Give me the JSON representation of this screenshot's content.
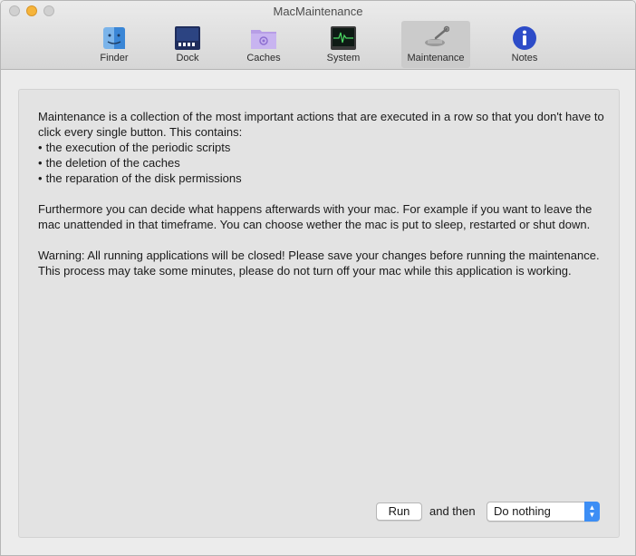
{
  "window": {
    "title": "MacMaintenance"
  },
  "toolbar": {
    "items": [
      {
        "label": "Finder",
        "icon": "finder-icon"
      },
      {
        "label": "Dock",
        "icon": "dock-icon"
      },
      {
        "label": "Caches",
        "icon": "caches-folder-icon"
      },
      {
        "label": "System",
        "icon": "activity-monitor-icon"
      },
      {
        "label": "Maintenance",
        "icon": "wrench-icon",
        "selected": true
      },
      {
        "label": "Notes",
        "icon": "info-icon"
      }
    ]
  },
  "main": {
    "intro": "Maintenance is a collection of the most important actions that are executed in a row so that you don't have to click every single button. This contains:",
    "bullets": [
      "the execution of the periodic scripts",
      "the deletion of the caches",
      "the reparation of the disk permissions"
    ],
    "paragraph2": "Furthermore you can decide what happens afterwards with your mac. For example if you want to leave the mac unattended in that timeframe. You can choose wether the mac is put to sleep, restarted or shut down.",
    "warning": "Warning: All running applications will be closed! Please save your changes before running the maintenance. This process may take some minutes, please do not turn off your mac while this application is working."
  },
  "controls": {
    "run_label": "Run",
    "and_then_label": "and then",
    "after_action": "Do nothing"
  },
  "colors": {
    "accent": "#3d8ef5",
    "window_bg": "#ececec",
    "selected_tab": "#cbcbcb"
  }
}
